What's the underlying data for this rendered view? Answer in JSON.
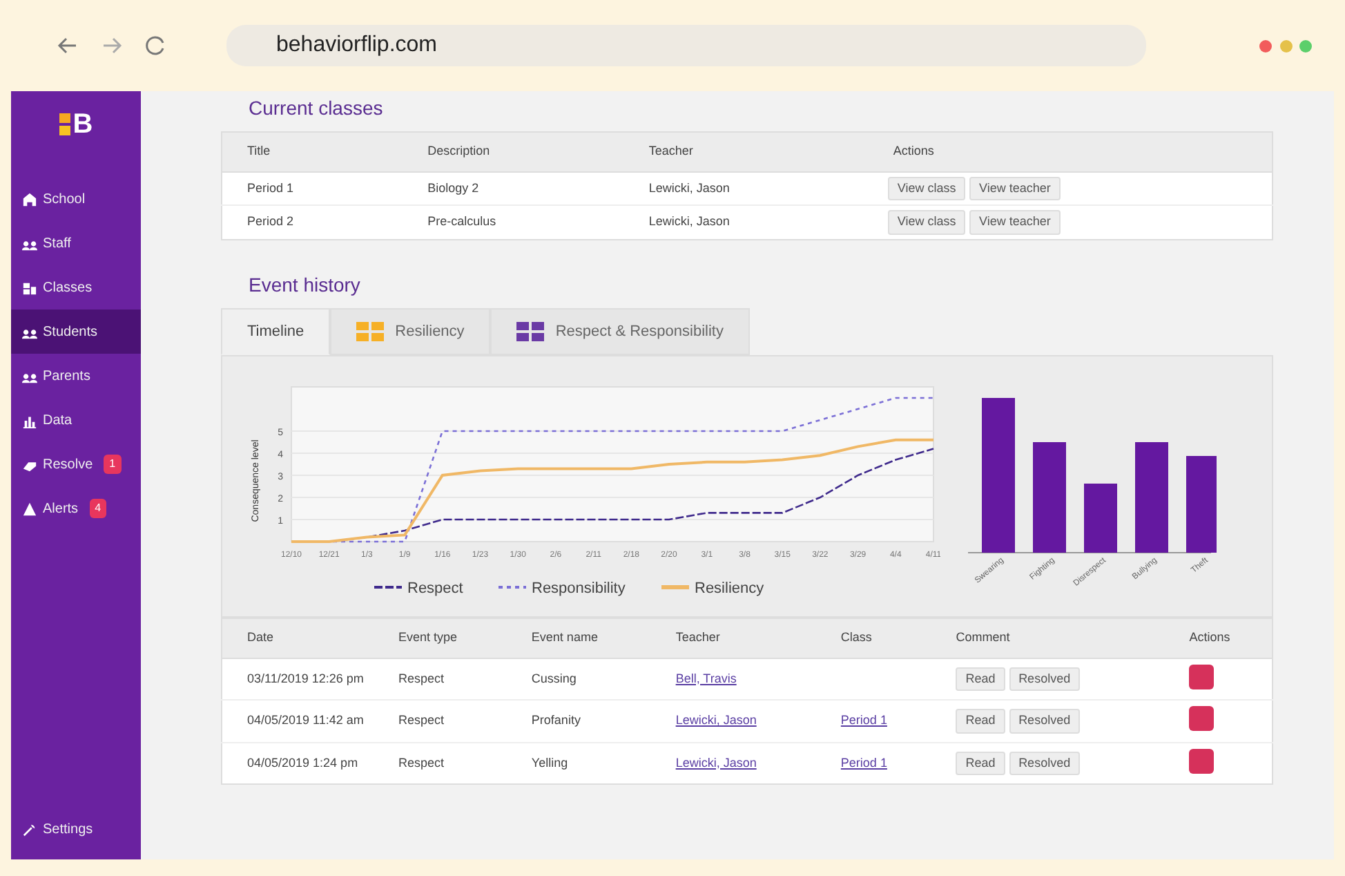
{
  "browser": {
    "url": "behaviorflip.com"
  },
  "sidebar": {
    "logo": "B",
    "items": [
      {
        "label": "School",
        "selected": false
      },
      {
        "label": "Staff",
        "selected": false
      },
      {
        "label": "Classes",
        "selected": false
      },
      {
        "label": "Students",
        "selected": true
      },
      {
        "label": "Parents",
        "selected": false
      },
      {
        "label": "Data",
        "selected": false
      },
      {
        "label": "Resolve",
        "selected": false,
        "badge": "1"
      },
      {
        "label": "Alerts",
        "selected": false,
        "badge": "4"
      }
    ],
    "footer": {
      "label": "Settings"
    }
  },
  "current_classes": {
    "title": "Current classes",
    "columns": [
      "Title",
      "Description",
      "Teacher",
      "Actions"
    ],
    "rows": [
      {
        "cells": [
          "Period 1",
          "Biology 2",
          "Lewicki, Jason"
        ],
        "actions": [
          "View class",
          "View teacher"
        ]
      },
      {
        "cells": [
          "Period 2",
          "Pre-calculus",
          "Lewicki, Jason"
        ],
        "actions": [
          "View class",
          "View teacher"
        ]
      }
    ]
  },
  "event_history": {
    "title": "Event history",
    "tabs": [
      {
        "label": "Timeline",
        "selected": true
      },
      {
        "label": "Resiliency",
        "selected": false
      },
      {
        "label": "Respect & Responsibility",
        "selected": false
      }
    ],
    "chart_data": {
      "type": "line",
      "ylabel": "Consequence level",
      "yticks": [
        1,
        2,
        3,
        4,
        5
      ],
      "ylim": [
        0,
        7
      ],
      "grid": true,
      "legend": "bottom",
      "categories": [
        "12/10",
        "12/21",
        "1/3",
        "1/9",
        "1/16",
        "1/23",
        "1/30",
        "2/6",
        "2/11",
        "2/18",
        "2/20",
        "3/1",
        "3/8",
        "3/15",
        "3/22",
        "3/29",
        "4/4",
        "4/11"
      ],
      "series": [
        {
          "name": "Respect",
          "color": "#3f2a8c",
          "line_style": "dashed",
          "values": [
            0,
            0,
            0.2,
            0.5,
            1,
            1,
            1,
            1,
            1,
            1,
            1,
            1.3,
            1.3,
            1.3,
            2,
            3,
            3.7,
            4.2
          ]
        },
        {
          "name": "Responsibility",
          "color": "#7b6fd6",
          "line_style": "dotted",
          "values": [
            0,
            0,
            0,
            0,
            5,
            5,
            5,
            5,
            5,
            5,
            5,
            5,
            5,
            5,
            5.5,
            6,
            6.5,
            6.5
          ]
        },
        {
          "name": "Resiliency",
          "color": "#f0b866",
          "line_style": "solid",
          "values": [
            0,
            0,
            0.2,
            0.3,
            3,
            3.2,
            3.3,
            3.3,
            3.3,
            3.3,
            3.5,
            3.6,
            3.6,
            3.7,
            3.9,
            4.3,
            4.6,
            4.6
          ]
        }
      ]
    },
    "bar_chart": {
      "labels": [
        "Swearing",
        "Fighting",
        "Disrespect",
        "Bullying",
        "Theft"
      ]
    },
    "table": {
      "columns": [
        "Date",
        "Event type",
        "Event name",
        "Teacher",
        "Class",
        "Comment",
        "Actions"
      ],
      "rows": [
        {
          "date": "03/11/2019 12:26 pm",
          "type": "Respect",
          "name": "Cussing",
          "teacher": "Bell, Travis",
          "comment": [
            "Read",
            "Resolved"
          ]
        },
        {
          "date": "04/05/2019 11:42 am",
          "type": "Respect",
          "name": "Profanity",
          "teacher": "Lewicki, Jason",
          "class": "Period 1",
          "comment": [
            "Read",
            "Resolved"
          ]
        },
        {
          "date": "04/05/2019 1:24 pm",
          "type": "Respect",
          "name": "Yelling",
          "teacher": "Lewicki, Jason",
          "class": "Period 1",
          "comment": [
            "Read",
            "Resolved"
          ]
        }
      ]
    }
  }
}
